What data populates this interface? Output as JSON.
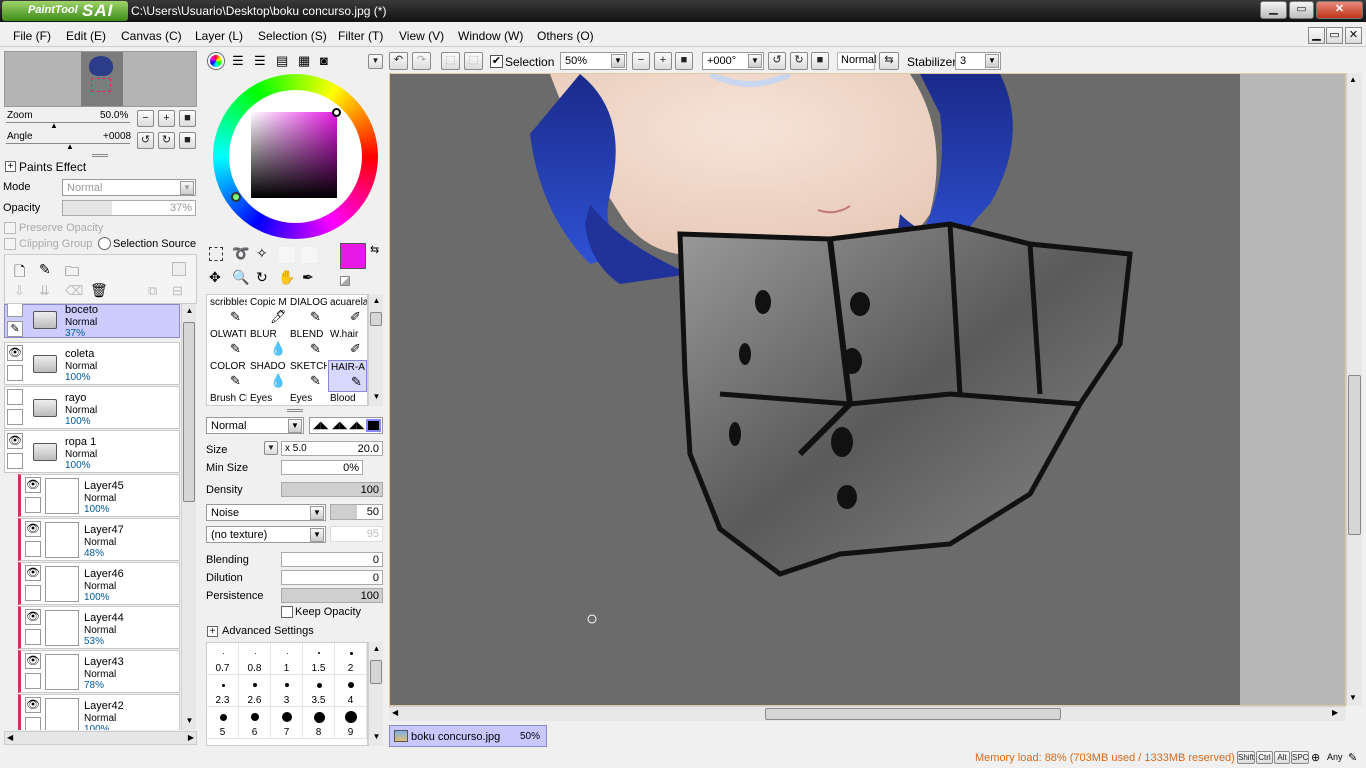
{
  "window": {
    "app_logo_small": "PaintTool",
    "app_logo_big": "SAI",
    "title": "C:\\Users\\Usuario\\Desktop\\boku concurso.jpg (*)",
    "minimize": "▁",
    "maximize": "▭",
    "close": "✕"
  },
  "menu": [
    "File (F)",
    "Edit (E)",
    "Canvas (C)",
    "Layer (L)",
    "Selection (S)",
    "Filter (T)",
    "View (V)",
    "Window (W)",
    "Others (O)"
  ],
  "navigator": {
    "zoom_label": "Zoom",
    "zoom_value": "50.0%",
    "angle_label": "Angle",
    "angle_value": "+0008"
  },
  "layer_panel": {
    "paints_effect": "Paints Effect",
    "mode_label": "Mode",
    "mode_value": "Normal",
    "opacity_label": "Opacity",
    "opacity_value": "37%",
    "preserve_opacity": "Preserve Opacity",
    "clipping_group": "Clipping Group",
    "selection_source": "Selection Source",
    "layers": [
      {
        "name": "boceto",
        "mode": "Normal",
        "opacity": "37%",
        "type": "folder",
        "visible": false,
        "selected": true
      },
      {
        "name": "coleta",
        "mode": "Normal",
        "opacity": "100%",
        "type": "folder",
        "visible": true,
        "selected": false
      },
      {
        "name": "rayo",
        "mode": "Normal",
        "opacity": "100%",
        "type": "folder",
        "visible": false,
        "selected": false
      },
      {
        "name": "ropa 1",
        "mode": "Normal",
        "opacity": "100%",
        "type": "folder",
        "visible": true,
        "selected": false
      },
      {
        "name": "Layer45",
        "mode": "Normal",
        "opacity": "100%",
        "type": "layer",
        "visible": true,
        "selected": false
      },
      {
        "name": "Layer47",
        "mode": "Normal",
        "opacity": "48%",
        "type": "layer",
        "visible": true,
        "selected": false
      },
      {
        "name": "Layer46",
        "mode": "Normal",
        "opacity": "100%",
        "type": "layer",
        "visible": true,
        "selected": false
      },
      {
        "name": "Layer44",
        "mode": "Normal",
        "opacity": "53%",
        "type": "layer",
        "visible": true,
        "selected": false
      },
      {
        "name": "Layer43",
        "mode": "Normal",
        "opacity": "78%",
        "type": "layer",
        "visible": true,
        "selected": false
      },
      {
        "name": "Layer42",
        "mode": "Normal",
        "opacity": "100%",
        "type": "layer",
        "visible": true,
        "selected": false
      }
    ]
  },
  "color": {
    "primary": "#e619e6",
    "secondary": "#dde4ff"
  },
  "brushes": [
    "scribbles",
    "Copic M",
    "DIALOG",
    "acuarela",
    "OLWATI",
    "BLUR",
    "BLEND",
    "W.hair",
    "COLOR",
    "SHADO",
    "SKETCH",
    "HAIR-A",
    "Brush Cl",
    "Eyes",
    "Eyes",
    "Blood"
  ],
  "selected_brush": "HAIR-A",
  "tool_settings": {
    "blend_mode": "Normal",
    "size_label": "Size",
    "size_mult": "x 5.0",
    "size_value": "20.0",
    "min_size_label": "Min Size",
    "min_size_value": "0%",
    "density_label": "Density",
    "density_value": "100",
    "noise_label": "Noise",
    "noise_value": "50",
    "texture_label": "(no texture)",
    "texture_value": "95",
    "blending_label": "Blending",
    "blending_value": "0",
    "dilution_label": "Dilution",
    "dilution_value": "0",
    "persistence_label": "Persistence",
    "persistence_value": "100",
    "keep_opacity": "Keep Opacity",
    "advanced_settings": "Advanced Settings"
  },
  "brush_sizes": [
    "0.7",
    "0.8",
    "1",
    "1.5",
    "2",
    "2.3",
    "2.6",
    "3",
    "3.5",
    "4",
    "5",
    "6",
    "7",
    "8",
    "9"
  ],
  "canvas_toolbar": {
    "selection_label": "Selection",
    "zoom": "50%",
    "angle": "+000°",
    "mode": "Normal",
    "stabilizer_label": "Stabilizer",
    "stabilizer_value": "3"
  },
  "doc_tab": {
    "name": "boku concurso.jpg",
    "zoom": "50%"
  },
  "status": {
    "memory": "Memory load: 88% (703MB used / 1333MB reserved)",
    "keys": [
      "Shift",
      "Ctrl",
      "Alt",
      "SPC",
      "Any"
    ]
  }
}
